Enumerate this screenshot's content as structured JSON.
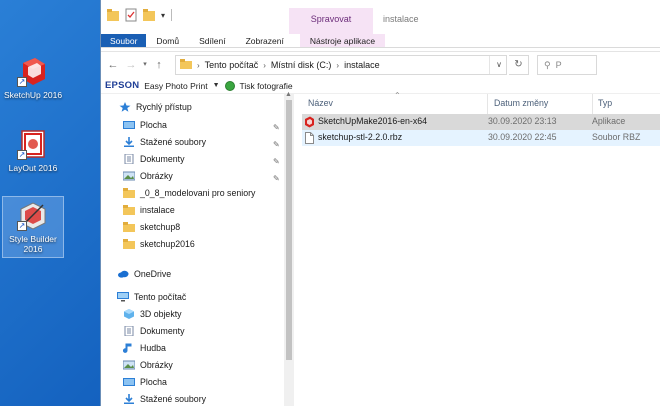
{
  "desktop": {
    "icons": [
      {
        "label": "SketchUp 2016"
      },
      {
        "label": "LayOut 2016"
      },
      {
        "label": "Style Builder 2016"
      }
    ]
  },
  "window": {
    "title": "instalace",
    "manage_tab": "Spravovat",
    "ribbon_tabs": [
      "Soubor",
      "Domů",
      "Sdílení",
      "Zobrazení",
      "Nástroje aplikace"
    ],
    "address": [
      "Tento počítač",
      "Místní disk (C:)",
      "instalace"
    ],
    "search_placeholder": "P"
  },
  "toolbar2": {
    "epson": "EPSON",
    "easy_photo_print": "Easy Photo Print",
    "print_photos": "Tisk fotografie"
  },
  "navpane": {
    "items": [
      {
        "label": "Rychlý přístup",
        "icon": "star-icon",
        "pinned": false
      },
      {
        "label": "Plocha",
        "icon": "desktop-folder-icon",
        "pinned": true
      },
      {
        "label": "Stažené soubory",
        "icon": "download-icon",
        "pinned": true
      },
      {
        "label": "Dokumenty",
        "icon": "documents-icon",
        "pinned": true
      },
      {
        "label": "Obrázky",
        "icon": "pictures-icon",
        "pinned": true
      },
      {
        "label": "_0_8_modelovani pro seniory",
        "icon": "folder-icon",
        "pinned": false
      },
      {
        "label": "instalace",
        "icon": "folder-icon",
        "pinned": false
      },
      {
        "label": "sketchup8",
        "icon": "folder-icon",
        "pinned": false
      },
      {
        "label": "sketchup2016",
        "icon": "folder-icon",
        "pinned": false
      },
      {
        "label": "OneDrive",
        "icon": "cloud-icon",
        "pinned": false
      },
      {
        "label": "Tento počítač",
        "icon": "computer-icon",
        "pinned": false
      },
      {
        "label": "3D objekty",
        "icon": "3d-objects-icon",
        "pinned": false
      },
      {
        "label": "Dokumenty",
        "icon": "documents-icon",
        "pinned": false
      },
      {
        "label": "Hudba",
        "icon": "music-icon",
        "pinned": false
      },
      {
        "label": "Obrázky",
        "icon": "pictures-icon",
        "pinned": false
      },
      {
        "label": "Plocha",
        "icon": "desktop-folder-icon",
        "pinned": false
      },
      {
        "label": "Stažené soubory",
        "icon": "download-icon",
        "pinned": false
      }
    ]
  },
  "filelist": {
    "columns": [
      "Název",
      "Datum změny",
      "Typ"
    ],
    "rows": [
      {
        "name": "SketchUpMake2016-en-x64",
        "date": "30.09.2020 23:13",
        "type": "Aplikace",
        "icon": "sketchup-app-icon"
      },
      {
        "name": "sketchup-stl-2.2.0.rbz",
        "date": "30.09.2020 22:45",
        "type": "Soubor RBZ",
        "icon": "file-icon"
      }
    ]
  },
  "colors": {
    "accent": "#1a5fb4",
    "manage_tab_bg": "#f6e3f5",
    "selected_row": "#d9d9d9",
    "hover_row": "#e5f3ff"
  }
}
